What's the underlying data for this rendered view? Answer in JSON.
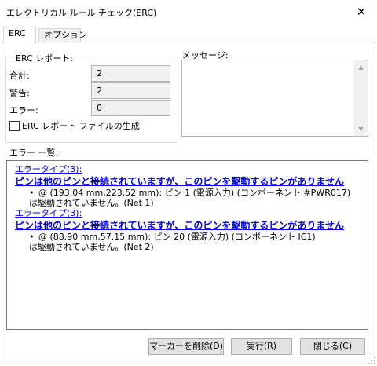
{
  "window": {
    "title": "エレクトリカル ルール チェック(ERC)",
    "close_icon": "close-icon"
  },
  "tabs": [
    {
      "label": "ERC",
      "active": true
    },
    {
      "label": "オプション",
      "active": false
    }
  ],
  "erc_report": {
    "group_label": "ERC レポート:",
    "rows": [
      {
        "label": "合計:",
        "value": "2"
      },
      {
        "label": "警告:",
        "value": "2"
      },
      {
        "label": "エラー:",
        "value": "0"
      }
    ],
    "generate_file": {
      "label": "ERC レポート ファイルの生成",
      "checked": false
    }
  },
  "messages": {
    "label": "メッセージ:",
    "text": ""
  },
  "error_list": {
    "label": "エラー 一覧:",
    "items": [
      {
        "type": "エラータイプ(3):",
        "heading": "ピンは他のピンと接続されていますが、このピンを駆動するピンがありません",
        "detail_line1": "@ (193.04 mm,223.52 mm): ピン 1 (電源入力) (コンポーネント #PWR017)",
        "detail_line2": "は駆動されていません。(Net 1)"
      },
      {
        "type": "エラータイプ(3):",
        "heading": "ピンは他のピンと接続されていますが、このピンを駆動するピンがありません",
        "detail_line1": "@ (88.90 mm,57.15 mm): ピン 20 (電源入力) (コンポーネント IC1)",
        "detail_line2": "は駆動されていません。(Net 2)"
      }
    ]
  },
  "buttons": {
    "delete_markers": "マーカーを削除(D)",
    "run": "実行(R)",
    "close": "閉じる(C)"
  },
  "colors": {
    "link": "#0000ee",
    "button_bg": "#e1e1e1",
    "readonly_bg": "#f0f0f0"
  }
}
